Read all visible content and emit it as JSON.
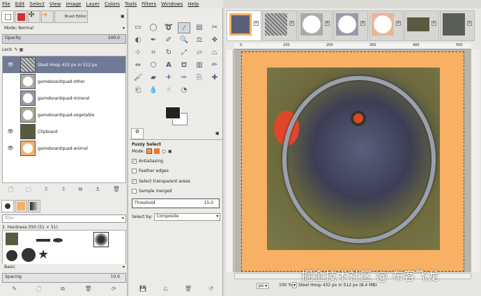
{
  "menu": [
    "File",
    "Edit",
    "Select",
    "View",
    "Image",
    "Layer",
    "Colors",
    "Tools",
    "Filters",
    "Windows",
    "Help"
  ],
  "left_panel": {
    "tab_brush_editor": "Brush Editor",
    "mode_label": "Mode: Normal",
    "opacity_label": "Opacity",
    "opacity_value": "100.0",
    "lock_label": "Lock:",
    "layers": [
      {
        "name": "Steel Hoop 432 px in 512 px",
        "visible": true,
        "selected": true
      },
      {
        "name": "gameboardquad-other",
        "visible": false
      },
      {
        "name": "gameboardquad-mineral",
        "visible": false
      },
      {
        "name": "gameboardquad-vegetable",
        "visible": false
      },
      {
        "name": "Clipboard",
        "visible": true
      },
      {
        "name": "gameboardquad-animal",
        "visible": true
      }
    ],
    "filter_placeholder": "filter",
    "brush_name": "2. Hardness 050 (51 × 51)",
    "brush_set": "Basic",
    "spacing_label": "Spacing",
    "spacing_value": "10.0"
  },
  "tool_options": {
    "title": "Fuzzy Select",
    "mode_label": "Mode:",
    "antialiasing": {
      "label": "Antialiasing",
      "checked": true
    },
    "feather": {
      "label": "Feather edges",
      "checked": false
    },
    "transparent": {
      "label": "Select transparent areas",
      "checked": true
    },
    "merged": {
      "label": "Sample merged",
      "checked": false
    },
    "threshold_label": "Threshold",
    "threshold_value": "15.0",
    "select_by_label": "Select by:",
    "select_by_value": "Composite"
  },
  "image_window": {
    "ruler_ticks": [
      "0",
      "100",
      "200",
      "300",
      "400",
      "500"
    ],
    "unit": "px",
    "zoom": "100 %",
    "status": "Steel Hoop 432 px in 512 px (8.4 MB)",
    "watermark": "掘金技术社区 @ 布客飞龙"
  },
  "colors": {
    "accent": "#6f7a96",
    "orange": "#f7b064"
  }
}
